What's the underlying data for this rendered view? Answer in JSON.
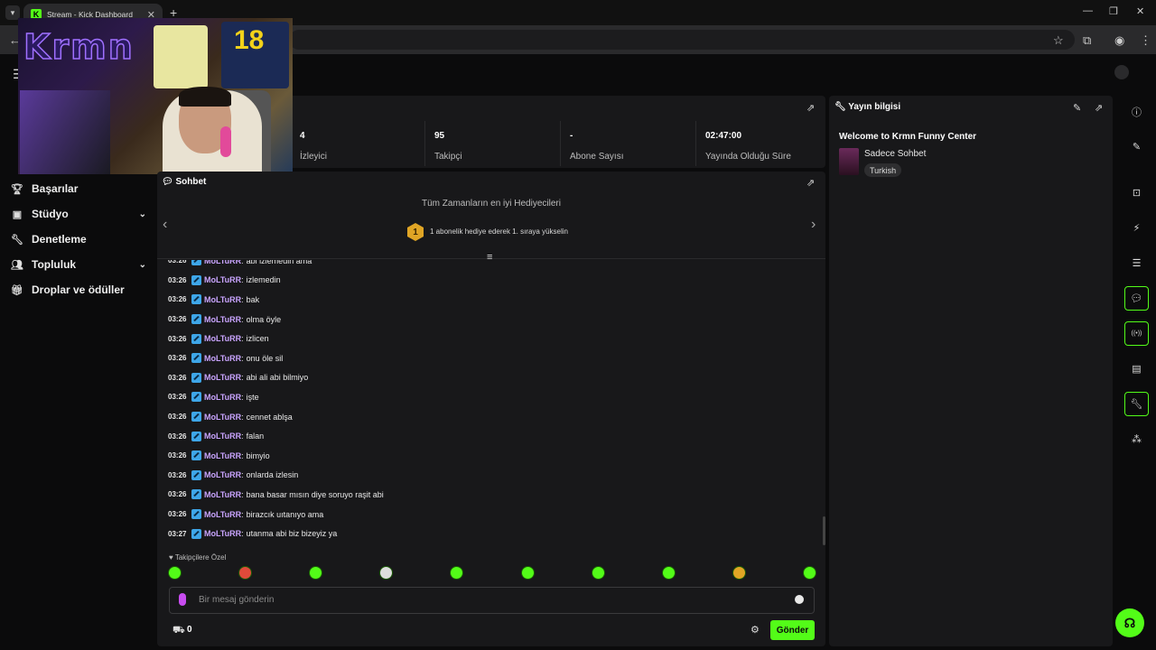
{
  "browser": {
    "tab_title": "Stream - Kick Dashboard",
    "tab_favicon": "K"
  },
  "sidebar": {
    "items": [
      {
        "label": "Başarılar",
        "icon": "trophy-icon",
        "expandable": false
      },
      {
        "label": "Stüdyo",
        "icon": "studio-icon",
        "expandable": true
      },
      {
        "label": "Denetleme",
        "icon": "wrench-icon",
        "expandable": false
      },
      {
        "label": "Topluluk",
        "icon": "people-icon",
        "expandable": true
      },
      {
        "label": "Droplar ve ödüller",
        "icon": "gift-icon",
        "expandable": false
      }
    ]
  },
  "stats": [
    {
      "value": "4",
      "label": "İzleyici"
    },
    {
      "value": "95",
      "label": "Takipçi"
    },
    {
      "value": "-",
      "label": "Abone Sayısı"
    },
    {
      "value": "02:47:00",
      "label": "Yayında Olduğu Süre"
    }
  ],
  "chat": {
    "title": "Sohbet",
    "top_gifters_title": "Tüm Zamanların en iyi Hediyecileri",
    "gift_rank": "1",
    "gift_prompt": "1 abonelik hediye ederek 1. sıraya yükselin",
    "messages": [
      {
        "time": "03:26",
        "user": "MoLTuRR",
        "text": "abi izlemedin ama"
      },
      {
        "time": "03:26",
        "user": "MoLTuRR",
        "text": "izlemedin"
      },
      {
        "time": "03:26",
        "user": "MoLTuRR",
        "text": "bak"
      },
      {
        "time": "03:26",
        "user": "MoLTuRR",
        "text": "olma öyle"
      },
      {
        "time": "03:26",
        "user": "MoLTuRR",
        "text": "izlicen"
      },
      {
        "time": "03:26",
        "user": "MoLTuRR",
        "text": "onu öle sil"
      },
      {
        "time": "03:26",
        "user": "MoLTuRR",
        "text": "abi ali abi bilmiyo"
      },
      {
        "time": "03:26",
        "user": "MoLTuRR",
        "text": "işte"
      },
      {
        "time": "03:26",
        "user": "MoLTuRR",
        "text": "cennet ablşa"
      },
      {
        "time": "03:26",
        "user": "MoLTuRR",
        "text": "falan"
      },
      {
        "time": "03:26",
        "user": "MoLTuRR",
        "text": "bimyio"
      },
      {
        "time": "03:26",
        "user": "MoLTuRR",
        "text": "onlarda izlesin"
      },
      {
        "time": "03:26",
        "user": "MoLTuRR",
        "text": "bana basar mısın diye soruyo raşit abi"
      },
      {
        "time": "03:26",
        "user": "MoLTuRR",
        "text": "birazcık uıtanıyo ama"
      },
      {
        "time": "03:27",
        "user": "MoLTuRR",
        "text": "utanma abi biz bizeyiz ya"
      }
    ],
    "followers_only": "Takipçilere Özel",
    "input_placeholder": "Bir mesaj gönderin",
    "kick_count": "0",
    "send_label": "Gönder"
  },
  "stream_info": {
    "title": "Yayın bilgisi",
    "stream_title": "Welcome to Krmn Funny Center",
    "category": "Sadece Sohbet",
    "language": "Turkish"
  },
  "webcam": {
    "neon_sign": "Krmn",
    "jersey_number": "18"
  },
  "colors": {
    "accent": "#53fc18",
    "username": "#c9a4ff",
    "panel": "#18181a",
    "background": "#0b0b0c"
  },
  "icons": {
    "rail": [
      "info-icon",
      "pencil-icon",
      "screen-icon",
      "lightning-icon",
      "list-icon",
      "chat-icon",
      "broadcast-icon",
      "layout-icon",
      "wrench-icon",
      "share-icon"
    ],
    "rail_active": [
      false,
      false,
      false,
      false,
      false,
      true,
      true,
      false,
      true,
      false
    ]
  }
}
